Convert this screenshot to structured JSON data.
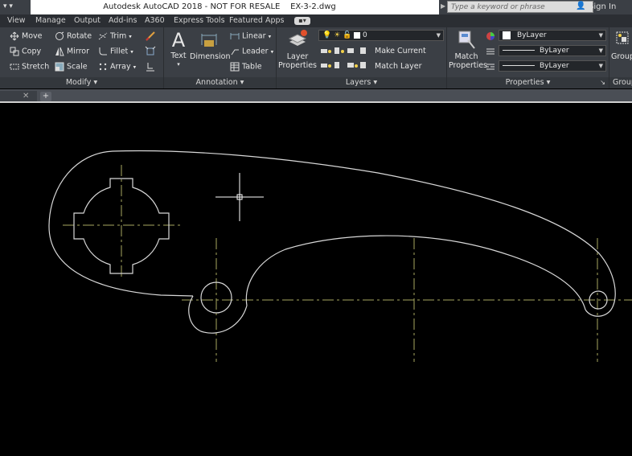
{
  "app": {
    "title": "Autodesk AutoCAD 2018 - NOT FOR RESALE",
    "filename": "EX-3-2.dwg",
    "search_placeholder": "Type a keyword or phrase",
    "sign_in": "Sign In"
  },
  "menu_tabs": [
    "View",
    "Manage",
    "Output",
    "Add-ins",
    "A360",
    "Express Tools",
    "Featured Apps"
  ],
  "ribbon": {
    "modify": {
      "title": "Modify",
      "tools": [
        "Move",
        "Rotate",
        "Trim",
        "Copy",
        "Mirror",
        "Fillet",
        "Stretch",
        "Scale",
        "Array"
      ]
    },
    "annotation": {
      "title": "Annotation",
      "text": "Text",
      "dimension": "Dimension",
      "linear": "Linear",
      "leader": "Leader",
      "table": "Table"
    },
    "layers": {
      "title": "Layers",
      "layer_properties_1": "Layer",
      "layer_properties_2": "Properties",
      "current_layer": "0",
      "make_current": "Make Current",
      "match_layer": "Match Layer"
    },
    "properties": {
      "title": "Properties",
      "match_1": "Match",
      "match_2": "Properties",
      "color": "ByLayer",
      "linetype": "ByLayer",
      "lineweight": "ByLayer"
    },
    "groups": {
      "title": "Group",
      "button": "Group"
    }
  },
  "colors": {
    "geometry": "#d8d8d8",
    "centerline": "#a8a860",
    "background": "#000000",
    "ribbon": "#3b3f45",
    "red_dot": "#e0502c"
  },
  "icons": [
    "move-icon",
    "rotate-icon",
    "trim-icon",
    "copy-icon",
    "mirror-icon",
    "fillet-icon",
    "stretch-icon",
    "scale-icon",
    "array-icon",
    "crosshair-cursor"
  ]
}
